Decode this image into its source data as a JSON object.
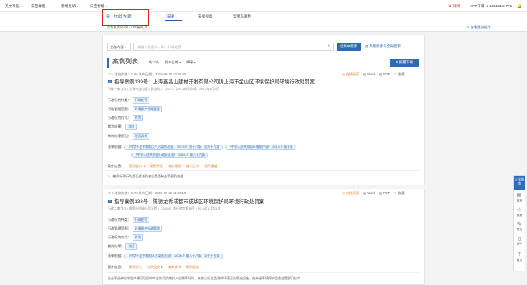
{
  "topbar": {
    "menus": [
      {
        "label": "英文导航"
      },
      {
        "label": "法宝群组"
      },
      {
        "label": "新增投诉"
      },
      {
        "label": "法宝智能"
      }
    ],
    "vip_label": "律师",
    "app_label": "APP下载",
    "phone": "18543161771",
    "accent": "#1f5ea8"
  },
  "subhead": {
    "module": "行政专题",
    "tabs": [
      "法律",
      "法规规章",
      "案例与裁判"
    ],
    "stats_prefix": "共检索到",
    "stats_count": "2,007,736",
    "stats_suffix": "篇文书",
    "right_link": "查看服务组件"
  },
  "search": {
    "select_value": "全部内容",
    "placeholder": "请输入检索词，如：行政处罚",
    "search_button": "结果中检索",
    "advanced_link": "高级检索与全局检索"
  },
  "list": {
    "title": "案例列表",
    "count_label": "共",
    "count": "22",
    "count_suffix": "条",
    "sort1": "发布日期",
    "sort2": "降序",
    "download_button": "批量下载"
  },
  "entries": [
    {
      "meta": "浏览次数：1196  发布日期：2020-09-30 10:06:40",
      "right": [
        "在线阅读",
        "Word",
        "PDF",
        "收藏"
      ],
      "tag": "1",
      "title": "指导案例139号：上海鑫晶山建材开发有限公司诉上海市金山区环境保护局环境行政处罚案",
      "subtitle": "行政一审判决 | 上海市金山区人民法院 | （2017）沪0116行初2号 | 2017年8月2日",
      "fields": [
        {
          "label": "行政行为种类：",
          "chips": [
            "行政处罚"
          ]
        },
        {
          "label": "行政管理范围：",
          "chips": [
            "环境保护行政管理"
          ]
        },
        {
          "label": "行政行为方式：",
          "chips": [
            "作为"
          ]
        },
        {
          "label": "裁判结果：",
          "chips": [
            "驳回"
          ]
        },
        {
          "label": "审判结果原因：",
          "chips": [
            "驳回诉求"
          ]
        }
      ],
      "laws_label": "法律依据：",
      "laws": [
        "《中华人民共和国大气污染防治法》（2015）》第十八条、第九十九条",
        "《中华人民共和国环境保护法》（2014）》第十条",
        "《中华人民共和国行政诉讼法》（2015）》第六十九条"
      ],
      "links_label": "案件信息：",
      "links": [
        {
          "text": "案例要点",
          "count": "1"
        },
        {
          "text": "案例评注",
          "count": ""
        },
        {
          "text": "相似案例",
          "count": ""
        },
        {
          "text": "裁判文书",
          "count": ""
        },
        {
          "text": "案例报道",
          "count": ""
        }
      ],
      "excerpt": "1、被诉行政行为是否违法及被告是否有处罚权及依据……"
    },
    {
      "meta": "浏览次数：1173  发布日期：2020-09-30 21:09:10",
      "right": [
        "在线阅读",
        "Word",
        "PDF",
        "收藏"
      ],
      "tag": "2",
      "title": "指导案例138号：陈德龙诉成都市成华区环境保护局环境行政处罚案",
      "subtitle": "行政二审判决 | 成都市中级人民法院 | （2014）成行终字第19号 | 2014年11月21日",
      "fields": [
        {
          "label": "行政行为种类：",
          "chips": [
            "行政处罚"
          ]
        },
        {
          "label": "行政管理范围：",
          "chips": [
            "环境保护行政管理"
          ]
        },
        {
          "label": "行政行为方式：",
          "chips": [
            "作为"
          ]
        },
        {
          "label": "裁判结果：",
          "chips": [
            "驳回"
          ]
        }
      ],
      "laws_label": "法律依据：",
      "laws": [
        "《中华人民共和国水污染防治法》（2008）》第八十八条、第七十五条"
      ],
      "links_label": "案件信息：",
      "links": [
        {
          "text": "案例评注",
          "count": ""
        },
        {
          "text": "法院全文",
          "count": "1"
        },
        {
          "text": "裁判文书",
          "count": ""
        },
        {
          "text": "案例报道",
          "count": ""
        }
      ],
      "excerpt": "企业事业单位将生产建设项目中产生的污染物排入自然环境时，未依法设立监测的环境污染防治设施，在未经环境保护监督主管部门核实……"
    }
  ],
  "sidetool": {
    "head": "法宝服务",
    "items": [
      "推荐",
      "收藏",
      "意见",
      "APP",
      "置顶"
    ]
  }
}
